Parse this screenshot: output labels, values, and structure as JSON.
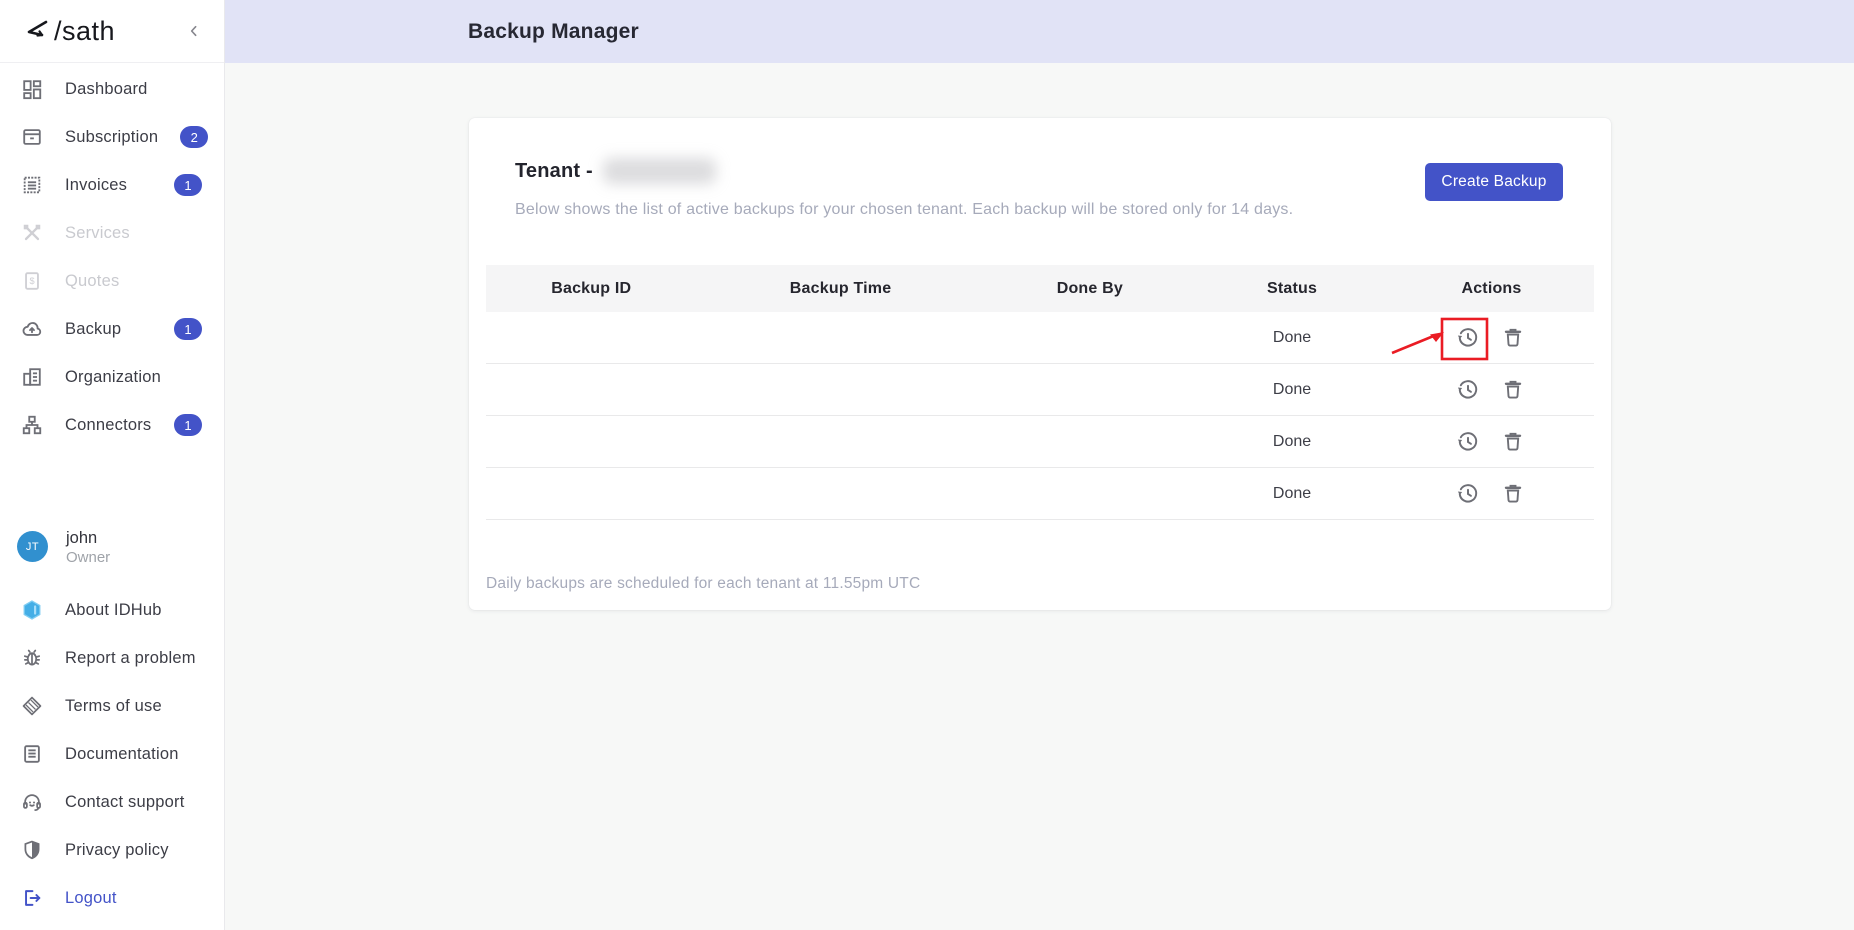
{
  "brand": {
    "logo_text": "&lt;/sath"
  },
  "sidebar": {
    "nav": [
      {
        "label": "Dashboard"
      },
      {
        "label": "Subscription",
        "badge": "2"
      },
      {
        "label": "Invoices",
        "badge": "1"
      },
      {
        "label": "Services",
        "disabled": true
      },
      {
        "label": "Quotes",
        "disabled": true
      },
      {
        "label": "Backup",
        "badge": "1"
      },
      {
        "label": "Organization"
      },
      {
        "label": "Connectors",
        "badge": "1"
      }
    ],
    "user": {
      "initials": "JT",
      "name": "john",
      "role": "Owner"
    },
    "footer_nav": [
      {
        "label": "About IDHub"
      },
      {
        "label": "Report a problem"
      },
      {
        "label": "Terms of use"
      },
      {
        "label": "Documentation"
      },
      {
        "label": "Contact support"
      },
      {
        "label": "Privacy policy"
      },
      {
        "label": "Logout"
      }
    ]
  },
  "header": {
    "title": "Backup Manager"
  },
  "card": {
    "tenant_label": "Tenant -",
    "tenant_name_redacted": true,
    "subtitle": "Below shows the list of active backups for your chosen tenant. Each backup will be stored only for 14 days.",
    "create_button_label": "Create Backup",
    "footer_note": "Daily backups are scheduled for each tenant at 11.55pm UTC"
  },
  "table": {
    "columns": [
      "Backup ID",
      "Backup Time",
      "Done By",
      "Status",
      "Actions"
    ],
    "rows": [
      {
        "status": "Done",
        "redacted": true,
        "annotated": true
      },
      {
        "status": "Done",
        "redacted": true
      },
      {
        "status": "Done",
        "redacted": true
      },
      {
        "status": "Done",
        "redacted": true
      }
    ]
  },
  "colors": {
    "accent": "#4353c8",
    "topbar": "#e1e3f6",
    "avatar": "#3190cf",
    "hexagon": "#44aee6",
    "annotation_red": "#ea1c24"
  }
}
